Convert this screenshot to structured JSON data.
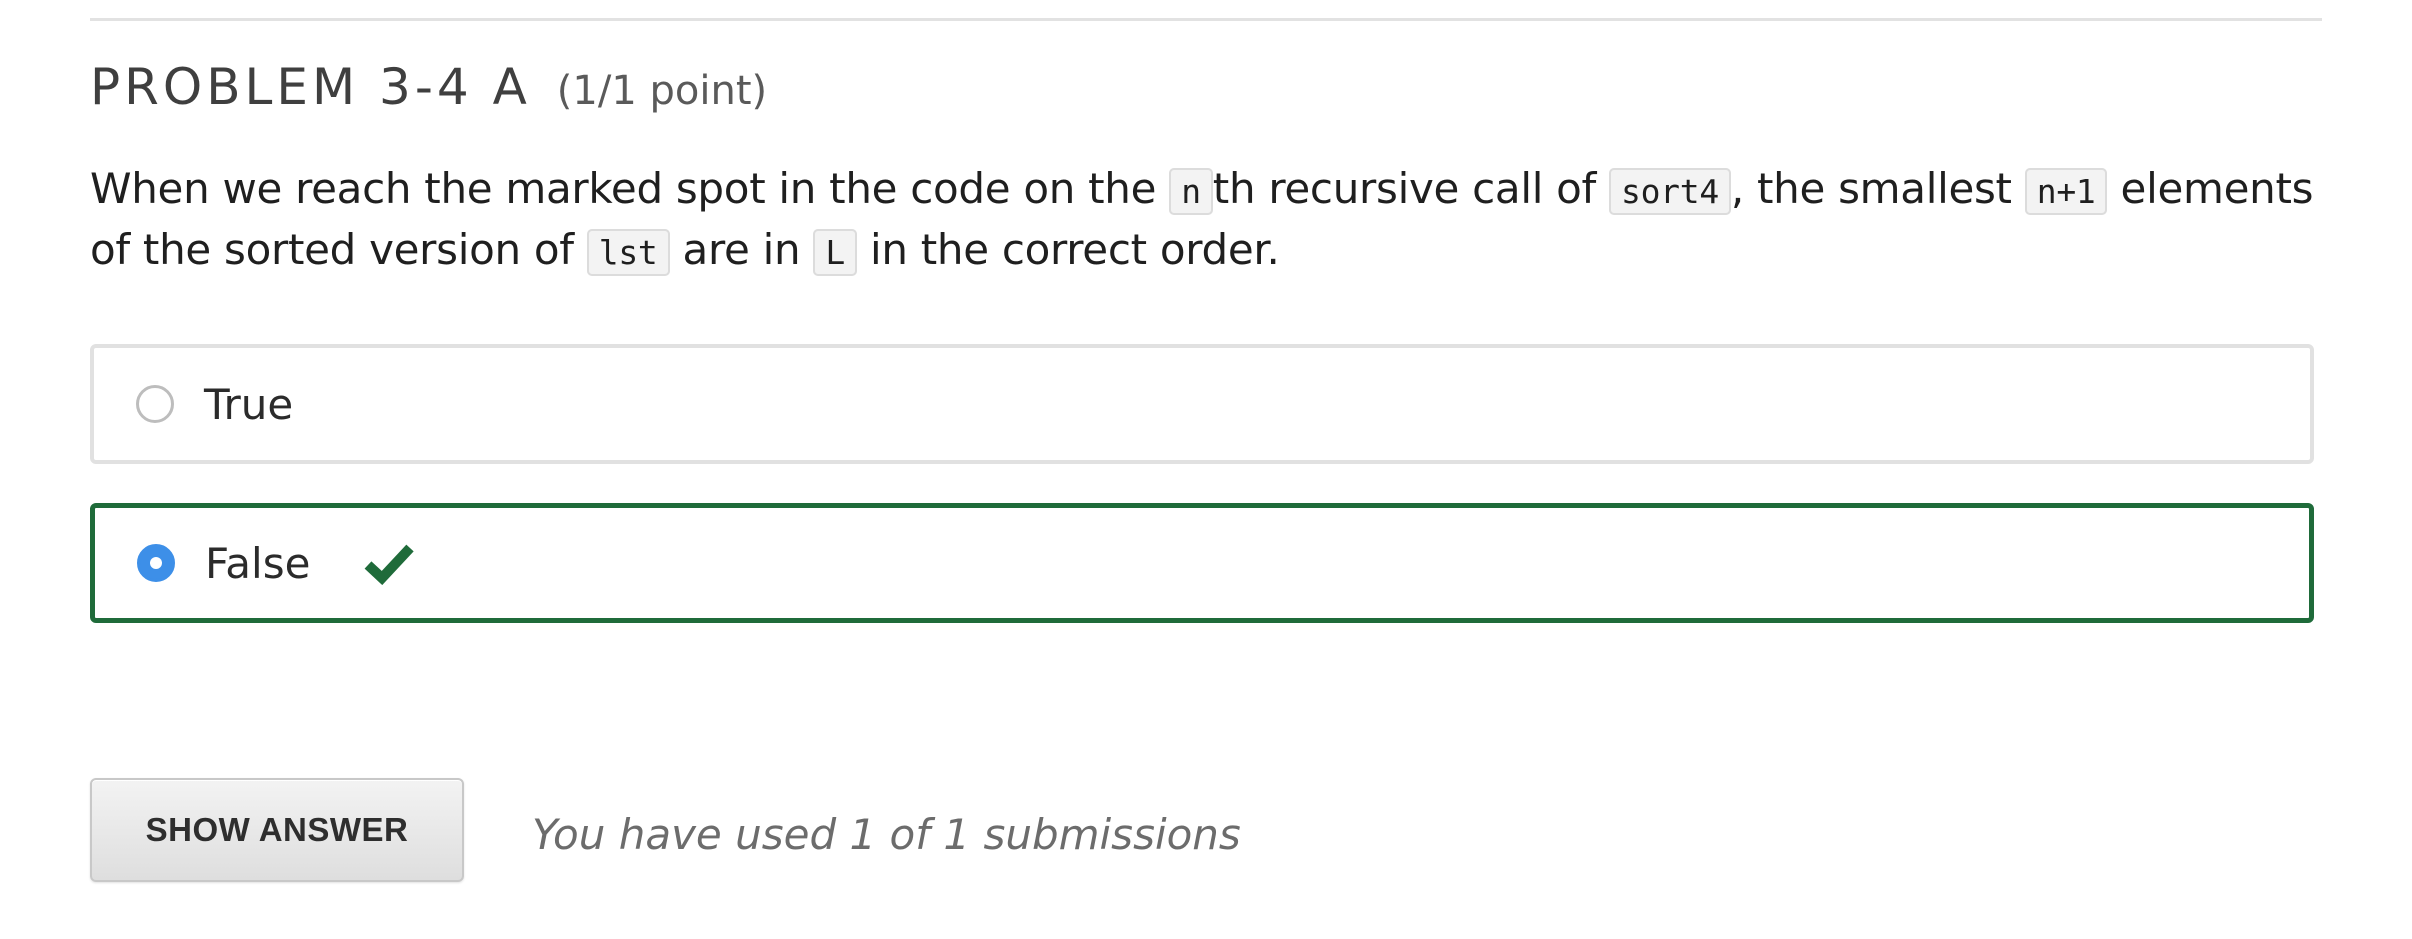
{
  "problem": {
    "title": "PROBLEM 3-4 A",
    "progress": "(1/1 point)"
  },
  "question": {
    "t1": "When we reach the marked spot in the code on the ",
    "c1": "n",
    "t2": "th recursive call of ",
    "c2": "sort4",
    "t3": ", the smallest ",
    "c3": "n+1",
    "t4": " elements of the sorted version of ",
    "c4": "lst",
    "t5": " are in ",
    "c5": "L",
    "t6": " in the correct order."
  },
  "choices": [
    {
      "label": "True",
      "selected": false,
      "icon": "radio-empty-icon"
    },
    {
      "label": "False",
      "selected": true,
      "correct": true,
      "icon": "radio-checked-icon"
    }
  ],
  "feedback": {
    "icon": "checkmark-icon",
    "correct_color": "#1f6b3a"
  },
  "actions": {
    "show_answer_label": "SHOW ANSWER"
  },
  "submissions": {
    "text": "You have used 1 of 1 submissions"
  },
  "colors": {
    "radio_selected": "#3d8fe8",
    "correct_border": "#1f6b3a",
    "neutral_border": "#e1e1e1"
  }
}
